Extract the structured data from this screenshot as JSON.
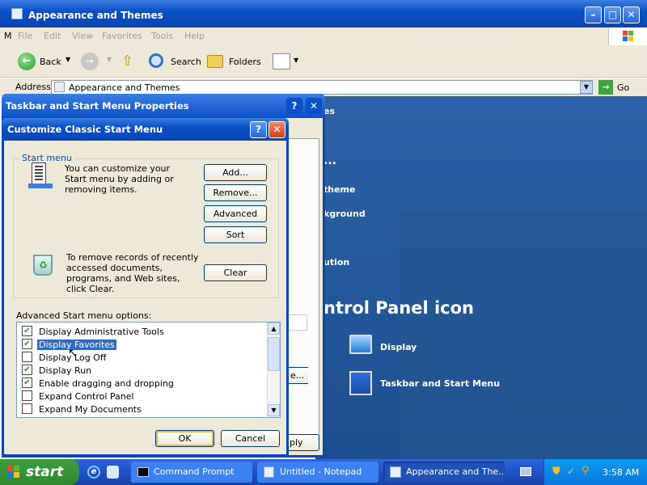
{
  "explorer": {
    "title": "Appearance and Themes",
    "menu": [
      "File",
      "Edit",
      "View",
      "Favorites",
      "Tools",
      "Help"
    ],
    "toolbar": {
      "back": "Back",
      "search": "Search",
      "folders": "Folders"
    },
    "address_label": "Address",
    "address_value": "Appearance and Themes",
    "go_label": "Go",
    "letter_m": "M",
    "partial_links": [
      "...",
      "theme",
      "kground",
      "ution"
    ],
    "partial_links_top": "es",
    "section_heading": "ntrol Panel icon",
    "cp_icons": [
      {
        "label": "Display"
      },
      {
        "label": "Taskbar and Start Menu"
      }
    ]
  },
  "taskbar_props": {
    "title": "Taskbar and Start Menu Properties",
    "partial_button": "e...",
    "partial_apply": "ply"
  },
  "customize": {
    "title": "Customize Classic Start Menu",
    "group_label": "Start menu",
    "start_menu_text": "You can customize your Start menu by adding or removing items.",
    "buttons": {
      "add": "Add...",
      "remove": "Remove...",
      "advanced": "Advanced",
      "sort": "Sort",
      "clear": "Clear"
    },
    "clear_text": "To remove records of recently accessed documents, programs, and Web sites, click Clear.",
    "advanced_label": "Advanced Start menu options:",
    "options": [
      {
        "label": "Display Administrative Tools",
        "checked": true
      },
      {
        "label": "Display Favorites",
        "checked": true
      },
      {
        "label": "Display Log Off",
        "checked": false
      },
      {
        "label": "Display Run",
        "checked": true
      },
      {
        "label": "Enable dragging and dropping",
        "checked": true
      },
      {
        "label": "Expand Control Panel",
        "checked": false
      },
      {
        "label": "Expand My Documents",
        "checked": false
      }
    ],
    "ok": "OK",
    "cancel": "Cancel"
  },
  "taskbar": {
    "start": "start",
    "tasks": [
      {
        "label": "Command Prompt"
      },
      {
        "label": "Untitled - Notepad"
      },
      {
        "label": "Appearance and The..."
      }
    ],
    "clock": "3:58 AM"
  },
  "colors": {
    "titlebar": "#0a50c8",
    "close": "#e04a2a",
    "dialog_bg": "#ece9d8",
    "selection": "#316ac5"
  }
}
